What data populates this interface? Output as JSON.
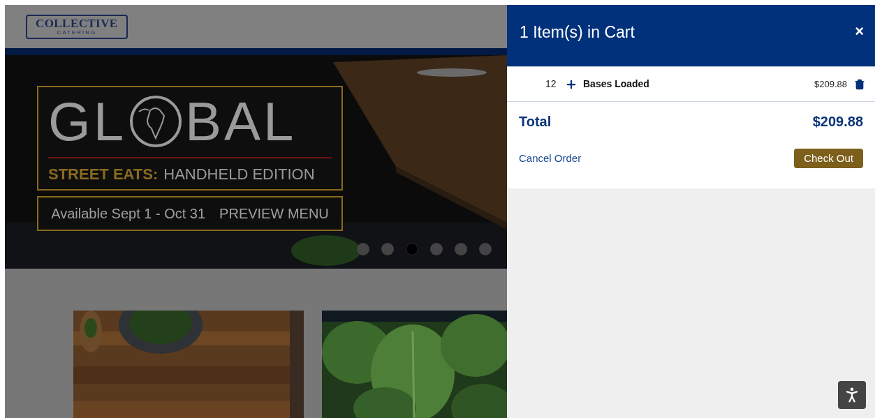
{
  "site": {
    "logo_name": "COLLECTIVE",
    "logo_sub": "CATERING"
  },
  "hero": {
    "title_start": "GL",
    "title_end": "BAL",
    "subtitle_bold": "STREET EATS:",
    "subtitle_rest": "HANDHELD EDITION",
    "availability": "Available Sept 1 - Oct 31",
    "preview_link": "PREVIEW MENU",
    "dots": [
      {
        "selected": false
      },
      {
        "selected": false
      },
      {
        "selected": true
      },
      {
        "selected": false
      },
      {
        "selected": false
      },
      {
        "selected": false
      }
    ]
  },
  "cart": {
    "title": "1 Item(s) in Cart",
    "close": "×",
    "items": [
      {
        "quantity": "12",
        "name": "Bases Loaded",
        "price": "$209.88"
      }
    ],
    "total_label": "Total",
    "total_value": "$209.88",
    "cancel": "Cancel Order",
    "checkout": "Check Out"
  }
}
